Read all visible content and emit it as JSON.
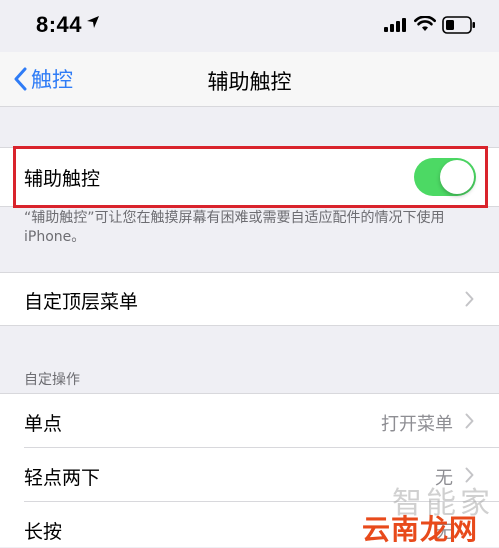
{
  "status_bar": {
    "time": "8:44"
  },
  "nav": {
    "back_label": "触控",
    "title": "辅助触控"
  },
  "assistive_touch": {
    "label": "辅助触控",
    "enabled": true
  },
  "footer_note": "“辅助触控”可让您在触摸屏幕有困难或需要自适应配件的情况下使用 iPhone。",
  "top_menu": {
    "label": "自定顶层菜单"
  },
  "custom_actions": {
    "header": "自定操作",
    "rows": [
      {
        "label": "单点",
        "value": "打开菜单"
      },
      {
        "label": "轻点两下",
        "value": "无"
      },
      {
        "label": "长按",
        "value": "无"
      }
    ]
  },
  "watermark": {
    "top": "智能家",
    "bottom": "云南龙网"
  },
  "colors": {
    "accent": "#2f7cf6",
    "switch_on": "#4cd964",
    "highlight": "#d9232c"
  }
}
